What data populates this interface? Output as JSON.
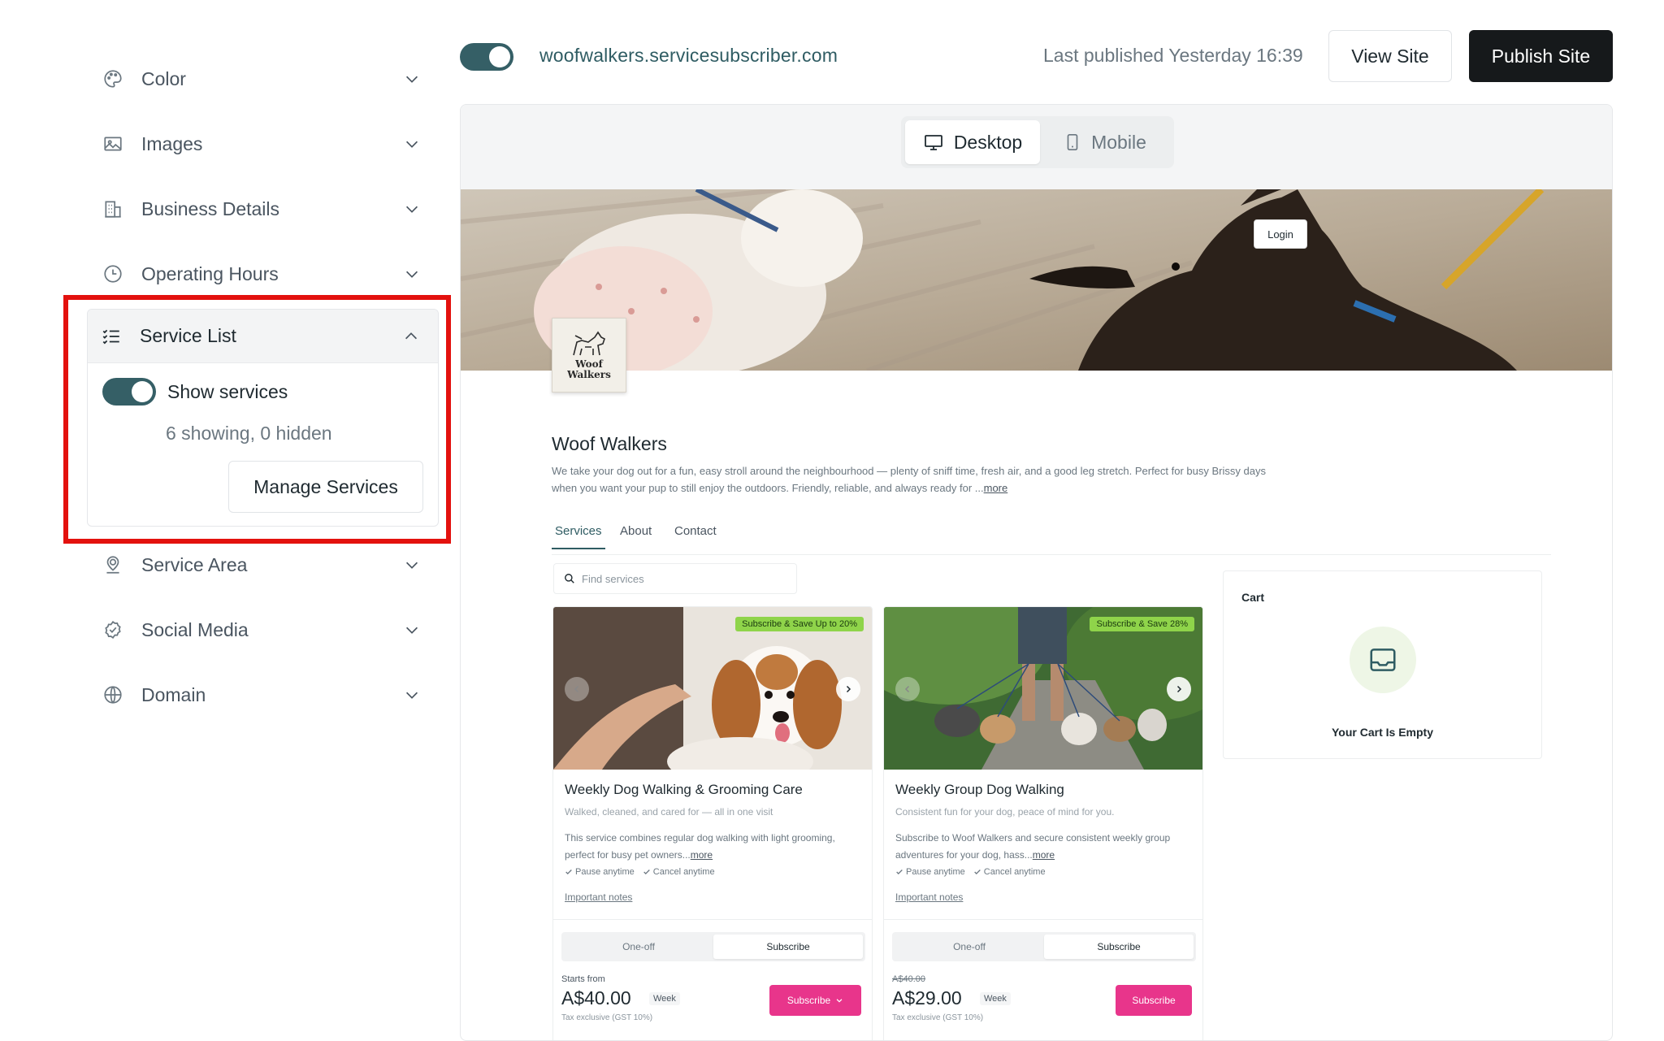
{
  "sidebar": {
    "items": [
      {
        "label": "Color",
        "icon": "palette-icon"
      },
      {
        "label": "Images",
        "icon": "image-icon"
      },
      {
        "label": "Business Details",
        "icon": "building-icon"
      },
      {
        "label": "Operating Hours",
        "icon": "clock-icon"
      },
      {
        "label": "Service Area",
        "icon": "location-icon"
      },
      {
        "label": "Social Media",
        "icon": "badge-check-icon"
      },
      {
        "label": "Domain",
        "icon": "globe-icon"
      }
    ],
    "service_list": {
      "label": "Service List",
      "toggle_label": "Show services",
      "toggle_on": true,
      "count_text": "6 showing, 0 hidden",
      "manage_label": "Manage Services"
    },
    "highlight_color": "#e3110e"
  },
  "topbar": {
    "site_enabled": true,
    "domain": "woofwalkers.servicesubscriber.com",
    "last_published": "Last published Yesterday 16:39",
    "view_site": "View Site",
    "publish_site": "Publish Site"
  },
  "preview": {
    "device_tabs": [
      {
        "label": "Desktop",
        "active": true
      },
      {
        "label": "Mobile",
        "active": false
      }
    ],
    "login": "Login",
    "logo_text_1": "Woof",
    "logo_text_2": "Walkers",
    "business_name": "Woof Walkers",
    "business_desc": "We take your dog out for a fun, easy stroll around the neighbourhood — plenty of sniff time, fresh air, and a good leg stretch. Perfect for busy Brissy days when you want your pup to still enjoy the outdoors. Friendly, reliable, and always ready for ...",
    "more": "more",
    "tabs": [
      "Services",
      "About",
      "Contact"
    ],
    "search_placeholder": "Find services",
    "services": [
      {
        "badge": "Subscribe & Save Up to 20%",
        "title": "Weekly Dog Walking & Grooming Care",
        "subtitle": "Walked, cleaned, and cared for — all in one visit",
        "desc": "This service combines regular dog walking with light grooming, perfect for busy pet owners...",
        "perks": [
          "Pause anytime",
          "Cancel anytime"
        ],
        "notes": "Important notes",
        "plans": [
          "One-off",
          "Subscribe"
        ],
        "active_plan": "Subscribe",
        "price_label": "Starts from",
        "price": "A$40.00",
        "unit": "Week",
        "tax": "Tax exclusive (GST 10%)",
        "cta": "Subscribe"
      },
      {
        "badge": "Subscribe & Save 28%",
        "title": "Weekly Group Dog Walking",
        "subtitle": "Consistent fun for your dog, peace of mind for you.",
        "desc": "Subscribe to Woof Walkers and secure consistent weekly group adventures for your dog, hass...",
        "perks": [
          "Pause anytime",
          "Cancel anytime"
        ],
        "notes": "Important notes",
        "plans": [
          "One-off",
          "Subscribe"
        ],
        "active_plan": "Subscribe",
        "price_label": "A$40.00",
        "price": "A$29.00",
        "unit": "Week",
        "tax": "Tax exclusive (GST 10%)",
        "cta": "Subscribe"
      }
    ],
    "cart": {
      "title": "Cart",
      "empty": "Your Cart Is Empty"
    }
  },
  "colors": {
    "brand_teal": "#355f66",
    "publish_bg": "#16191b",
    "badge_green": "#8fd44a",
    "cta_pink": "#e8358b"
  }
}
